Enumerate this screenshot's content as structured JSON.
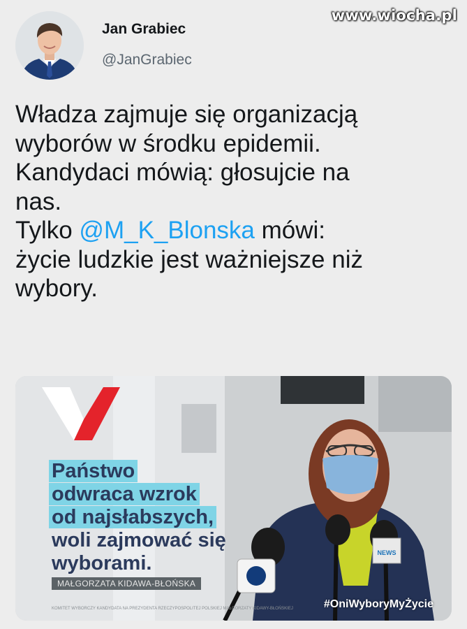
{
  "watermark": "www.wiocha.pl",
  "tweet": {
    "author": {
      "display_name": "Jan Grabiec",
      "handle": "@JanGrabiec"
    },
    "text_lines": [
      "Władza zajmuje się organizacją",
      "wyborów w środku epidemii.",
      "Kandydaci mówią: głosujcie na",
      "nas."
    ],
    "text_line5_before": "Tylko ",
    "mention": "@M_K_Blonska",
    "text_line5_after": " mówi:",
    "text_lines_end": [
      "życie ludzkie jest ważniejsze niż",
      "wybory."
    ],
    "mention_color": "#1da1f2"
  },
  "media": {
    "quote_lines": [
      {
        "text": "Państwo",
        "style": "highlight"
      },
      {
        "text": "odwraca wzrok",
        "style": "highlight"
      },
      {
        "text": "od najsłabszych,",
        "style": "highlight"
      },
      {
        "text": "woli zajmować się",
        "style": "plain"
      },
      {
        "text": "wyborami.",
        "style": "plain"
      }
    ],
    "author_tag": "MAŁGORZATA KIDAWA-BŁOŃSKA",
    "fineprint": "KOMITET WYBORCZY KANDYDATA NA PREZYDENTA RZECZYPOSPOLITEJ POLSKIEJ MAŁGORZATY KIDAWY-BŁOŃSKIEJ",
    "hashtag": "#OniWyboryMyŻycie",
    "mic_label": "NEWS",
    "colors": {
      "highlight": "#7fd4e6",
      "quote_text": "#2b3a5c",
      "logo_red": "#e4232b"
    }
  }
}
